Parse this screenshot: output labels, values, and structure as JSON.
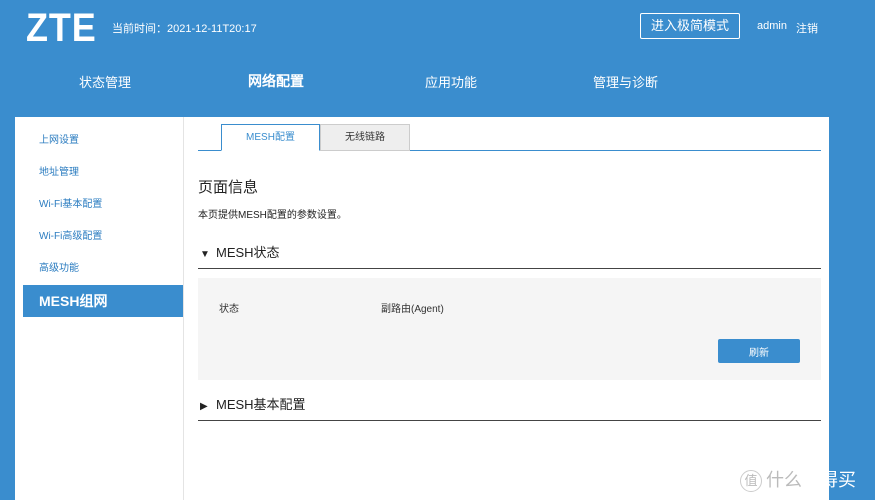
{
  "header": {
    "logo": "ZTE",
    "time_label": "当前时间：2021-12-11T20:17",
    "simple_mode": "进入极简模式",
    "user": "admin",
    "logout": "注销"
  },
  "nav": [
    "状态管理",
    "网络配置",
    "应用功能",
    "管理与诊断"
  ],
  "sidebar": [
    "上网设置",
    "地址管理",
    "Wi-Fi基本配置",
    "Wi-Fi高级配置",
    "高级功能",
    "MESH组网"
  ],
  "tabs": [
    "MESH配置",
    "无线链路"
  ],
  "page": {
    "title": "页面信息",
    "desc": "本页提供MESH配置的参数设置。"
  },
  "mesh_status": {
    "title": "MESH状态",
    "label": "状态",
    "value": "副路由(Agent)",
    "refresh": "刷新"
  },
  "mesh_basic": {
    "title": "MESH基本配置"
  },
  "watermark": {
    "icon": "值",
    "text1": "什么",
    "text2": "值得买"
  },
  "colors": {
    "primary": "#3a8dce"
  }
}
